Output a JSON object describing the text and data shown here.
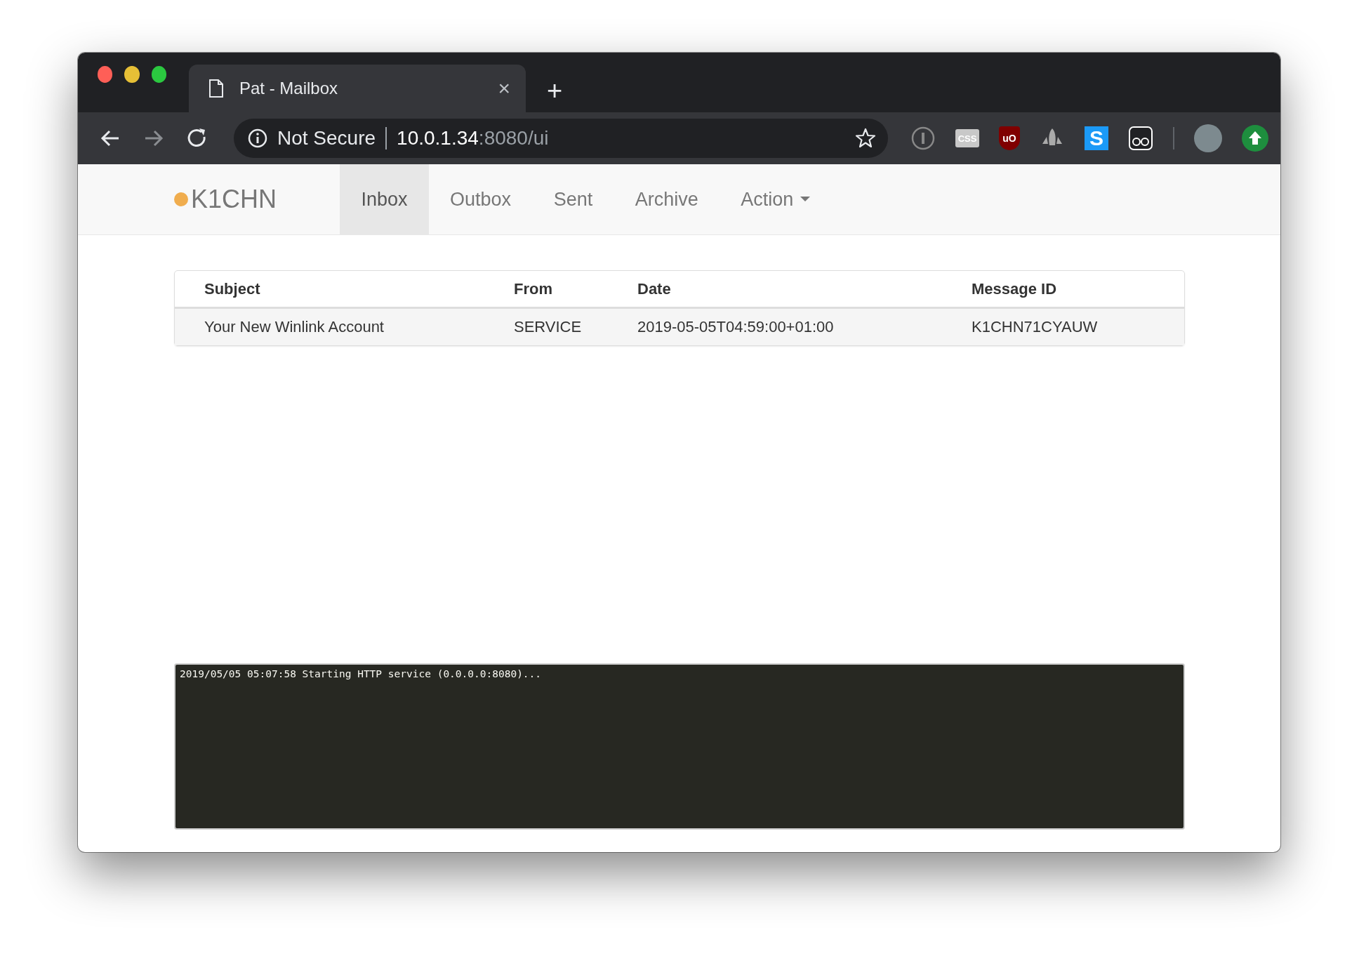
{
  "browser": {
    "tab": {
      "title": "Pat - Mailbox",
      "close": "×",
      "new_tab": "+"
    },
    "address": {
      "security": "Not Secure",
      "host": "10.0.1.34",
      "path": ":8080/ui"
    },
    "extensions": [
      {
        "kind": "info"
      },
      {
        "kind": "css",
        "glyph": "CSS"
      },
      {
        "kind": "shield",
        "glyph": "uO"
      },
      {
        "kind": "cloud"
      },
      {
        "kind": "letter",
        "glyph": "S"
      },
      {
        "kind": "glasses"
      },
      {
        "kind": "divider"
      },
      {
        "kind": "avatar"
      },
      {
        "kind": "upload"
      }
    ]
  },
  "navbar": {
    "brand": "K1CHN",
    "items": [
      {
        "label": "Inbox",
        "selected": true,
        "dropdown": false
      },
      {
        "label": "Outbox",
        "selected": false,
        "dropdown": false
      },
      {
        "label": "Sent",
        "selected": false,
        "dropdown": false
      },
      {
        "label": "Archive",
        "selected": false,
        "dropdown": false
      },
      {
        "label": "Action",
        "selected": false,
        "dropdown": true
      }
    ]
  },
  "table": {
    "columns": [
      "Subject",
      "From",
      "Date",
      "Message ID"
    ],
    "rows": [
      [
        "Your New Winlink Account",
        "SERVICE",
        "2019-05-05T04:59:00+01:00",
        "K1CHN71CYAUW"
      ]
    ]
  },
  "log": [
    "2019/05/05 05:07:58 Starting HTTP service (0.0.0.0:8080)..."
  ]
}
